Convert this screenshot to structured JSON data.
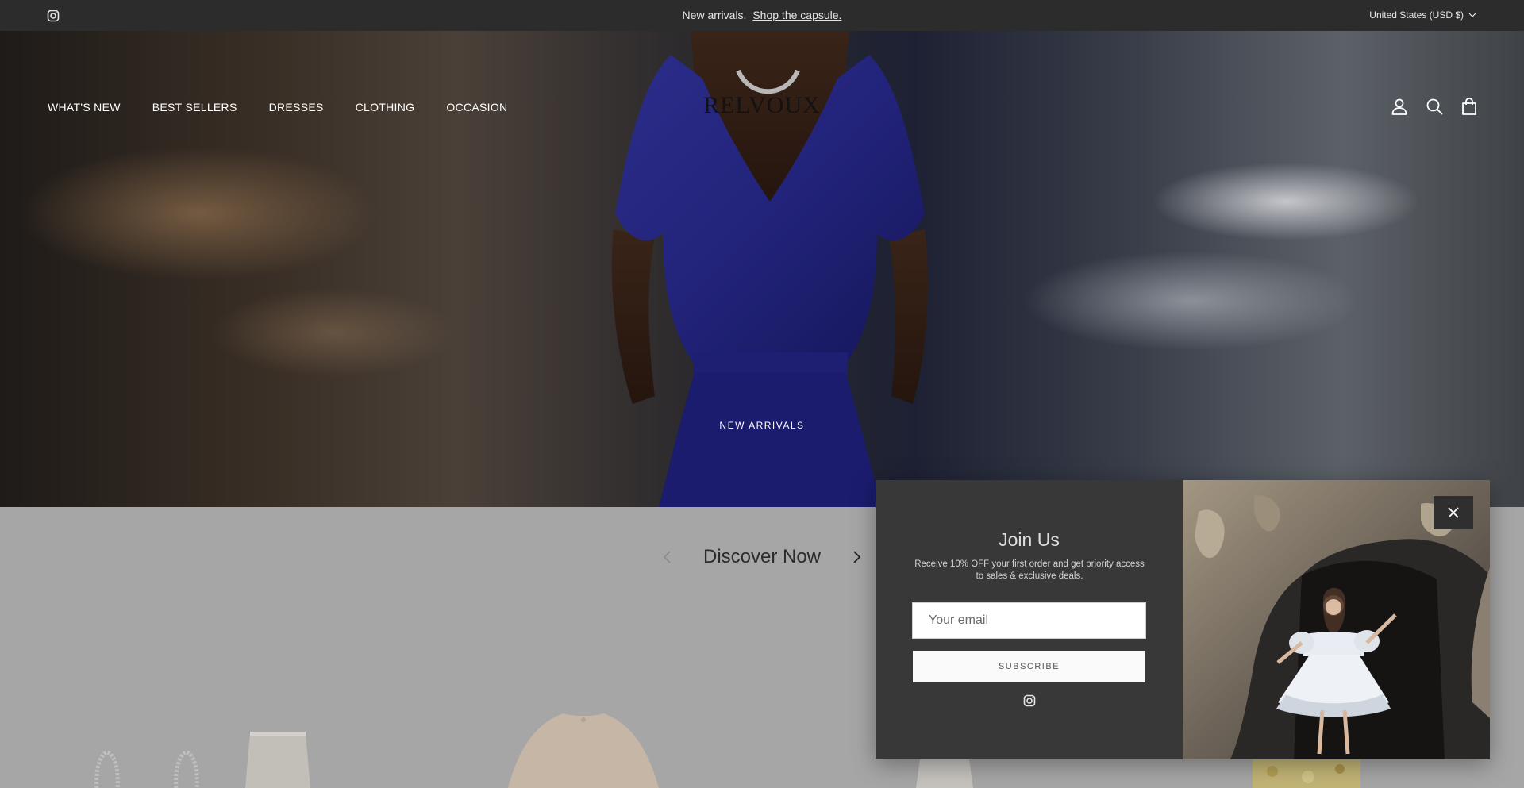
{
  "announcement": {
    "text": "New arrivals.",
    "link_text": "Shop the capsule.",
    "currency": "United States (USD $)"
  },
  "header": {
    "logo": "RELVOUX",
    "nav": [
      "WHAT'S NEW",
      "BEST SELLERS",
      "DRESSES",
      "CLOTHING",
      "OCCASION"
    ]
  },
  "hero": {
    "label": "NEW ARRIVALS"
  },
  "discover": {
    "title": "Discover Now"
  },
  "popup": {
    "title": "Join Us",
    "description": "Receive 10% OFF your first order and get priority access to sales & exclusive deals.",
    "email_placeholder": "Your email",
    "subscribe_label": "SUBSCRIBE"
  },
  "icons": {
    "instagram": "instagram-icon",
    "account": "user-icon",
    "search": "search-icon",
    "cart": "bag-icon",
    "close": "close-icon",
    "chevron": "chevron-down-icon"
  },
  "colors": {
    "topbar": "#2c2c2c",
    "popup_bg": "#383838",
    "dim_overlay": "#a6a6a6"
  }
}
